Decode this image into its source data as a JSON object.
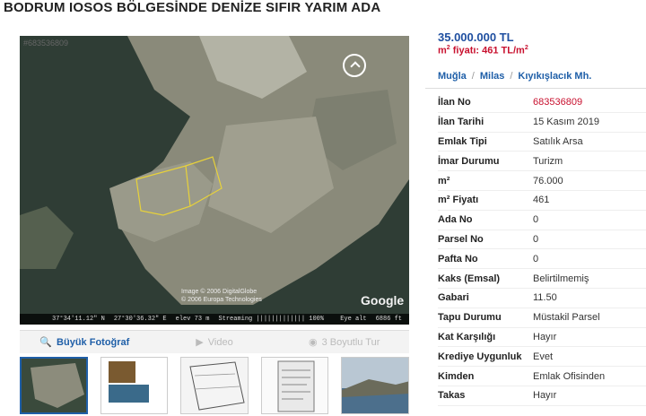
{
  "title": "BODRUM IOSOS BÖLGESİNDE DENİZE SIFIR YARIM ADA",
  "listing_badge": "#683536809",
  "photo": {
    "attribution_1": "Image © 2006 DigitalGlobe",
    "attribution_2": "© 2006 Europa Technologies",
    "google": "Google",
    "status": {
      "lat": "37°34'11.12\" N",
      "lon": "27°30'36.32\" E",
      "elev": "elev 73 m",
      "streaming": "Streaming ||||||||||||| 100%",
      "eye": "Eye alt",
      "size": "6886 ft"
    }
  },
  "media_tabs": [
    {
      "label": "Büyük Fotoğraf",
      "icon": "search-icon"
    },
    {
      "label": "Video",
      "icon": "video-camera-icon"
    },
    {
      "label": "3 Boyutlu Tur",
      "icon": "3d-tour-icon"
    }
  ],
  "price": "35.000.000 TL",
  "m2_price_label": "m",
  "m2_price_sup": "2",
  "m2_price_value": " fiyatı: 461 TL/m",
  "m2_price_sup2": "2",
  "location": [
    "Muğla",
    "Milas",
    "Kıyıkışlacık Mh."
  ],
  "details": [
    {
      "key": "İlan No",
      "value": "683536809",
      "highlight": true
    },
    {
      "key": "İlan Tarihi",
      "value": "15 Kasım 2019"
    },
    {
      "key": "Emlak Tipi",
      "value": "Satılık Arsa"
    },
    {
      "key": "İmar Durumu",
      "value": "Turizm"
    },
    {
      "key": "m²",
      "value": "76.000"
    },
    {
      "key": "m² Fiyatı",
      "value": "461"
    },
    {
      "key": "Ada No",
      "value": "0"
    },
    {
      "key": "Parsel No",
      "value": "0"
    },
    {
      "key": "Pafta No",
      "value": "0"
    },
    {
      "key": "Kaks (Emsal)",
      "value": "Belirtilmemiş"
    },
    {
      "key": "Gabari",
      "value": "11.50"
    },
    {
      "key": "Tapu Durumu",
      "value": "Müstakil Parsel"
    },
    {
      "key": "Kat Karşılığı",
      "value": "Hayır"
    },
    {
      "key": "Krediye Uygunluk",
      "value": "Evet"
    },
    {
      "key": "Kimden",
      "value": "Emlak Ofisinden"
    },
    {
      "key": "Takas",
      "value": "Hayır"
    }
  ],
  "colors": {
    "accent": "#1f5fa8",
    "price": "#1f4fa0",
    "highlight": "#c8102e"
  }
}
